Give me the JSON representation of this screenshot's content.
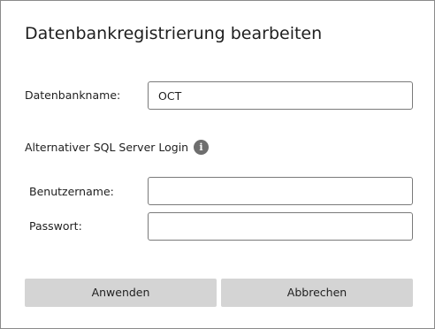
{
  "dialog": {
    "title": "Datenbankregistrierung bearbeiten"
  },
  "database": {
    "label": "Datenbankname:",
    "value": "OCT"
  },
  "alt_login": {
    "label": "Alternativer SQL Server Login",
    "info_glyph": "i",
    "info_icon": "info-icon"
  },
  "username": {
    "label": "Benutzername:",
    "value": ""
  },
  "password": {
    "label": "Passwort:",
    "value": ""
  },
  "buttons": {
    "apply": "Anwenden",
    "cancel": "Abbrechen"
  },
  "colors": {
    "button_bg": "#d4d4d4",
    "info_icon_bg": "#6e6e6e",
    "field_border": "#7a7a7a"
  }
}
